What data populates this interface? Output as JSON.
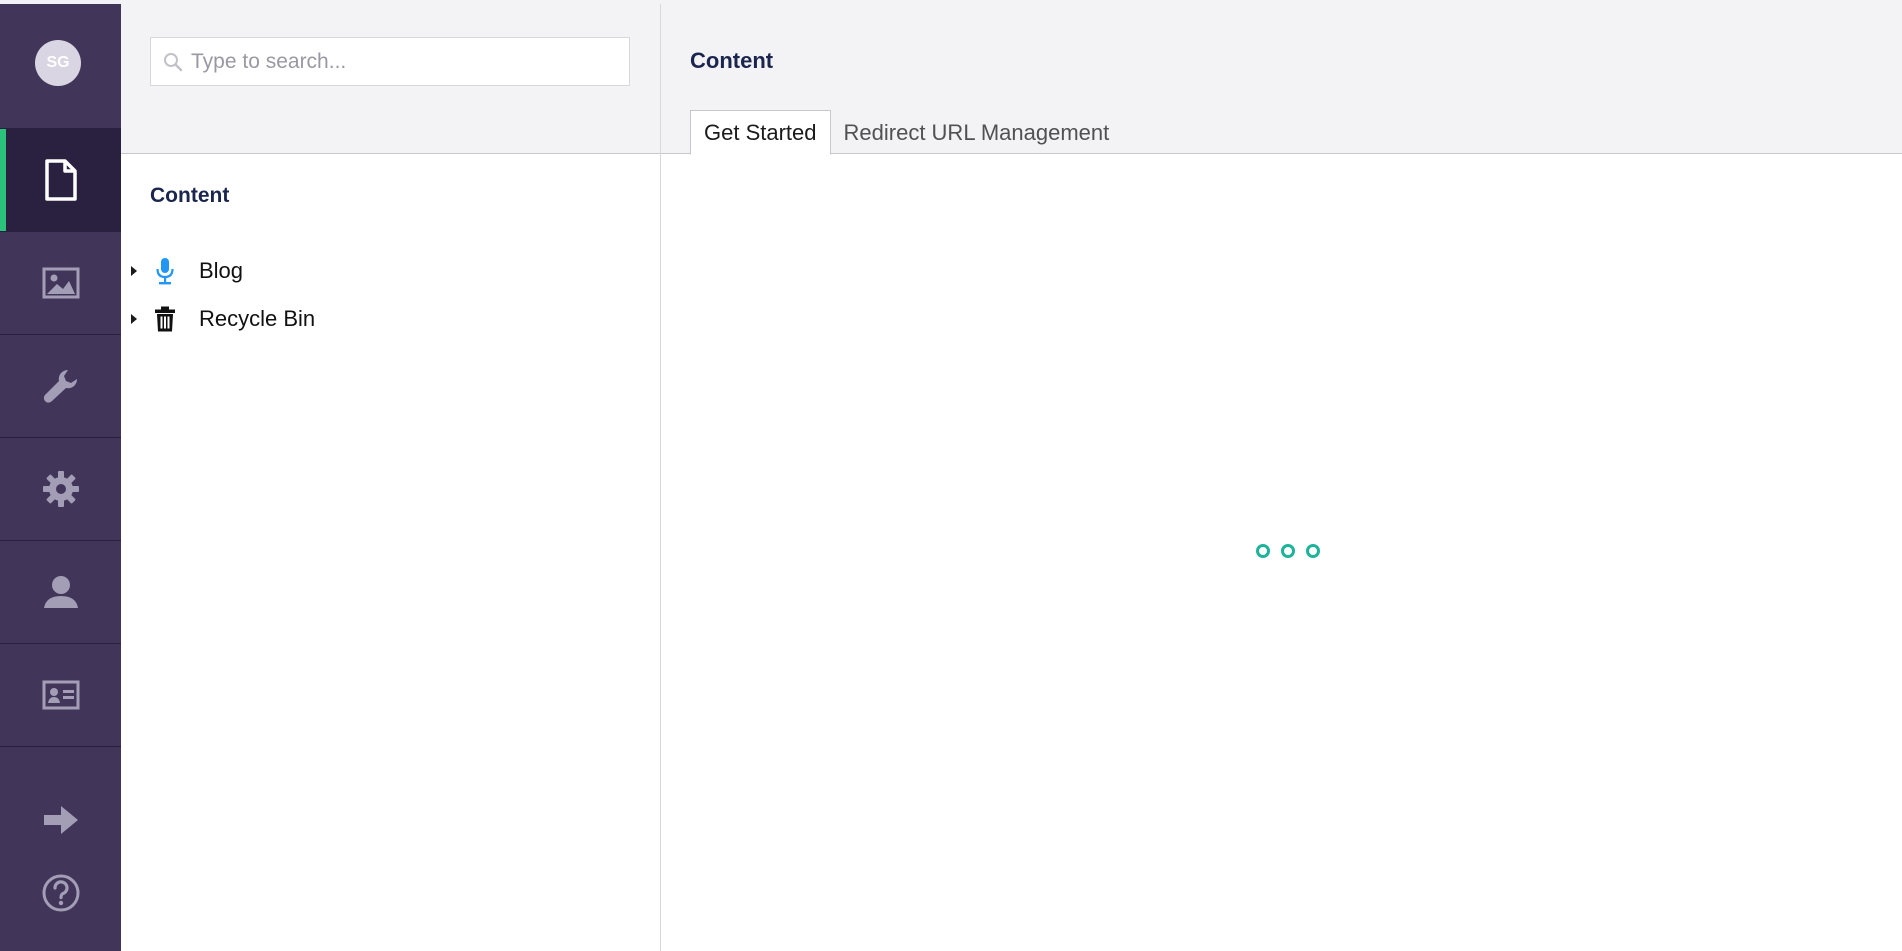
{
  "user": {
    "initials": "SG"
  },
  "sections": [
    {
      "name": "content",
      "icon": "document-icon",
      "active": true
    },
    {
      "name": "media",
      "icon": "image-icon",
      "active": false
    },
    {
      "name": "settings",
      "icon": "wrench-icon",
      "active": false
    },
    {
      "name": "developer",
      "icon": "gear-icon",
      "active": false
    },
    {
      "name": "users",
      "icon": "user-icon",
      "active": false
    },
    {
      "name": "members",
      "icon": "id-card-icon",
      "active": false
    }
  ],
  "bottom_actions": [
    {
      "name": "logout",
      "icon": "arrow-right-icon"
    },
    {
      "name": "help",
      "icon": "help-icon"
    }
  ],
  "search": {
    "placeholder": "Type to search...",
    "value": ""
  },
  "tree": {
    "title": "Content",
    "nodes": [
      {
        "label": "Blog",
        "icon": "microphone-icon",
        "icon_color": "#2196f3"
      },
      {
        "label": "Recycle Bin",
        "icon": "trash-icon",
        "icon_color": "#111111"
      }
    ]
  },
  "main": {
    "title": "Content",
    "tabs": [
      {
        "label": "Get Started",
        "active": true
      },
      {
        "label": "Redirect URL Management",
        "active": false
      }
    ]
  },
  "colors": {
    "rail_bg": "#413659",
    "rail_active": "#2a2140",
    "accent_green": "#2bc37c",
    "loader_teal": "#1fb39a",
    "header_bg": "#f3f3f5"
  }
}
